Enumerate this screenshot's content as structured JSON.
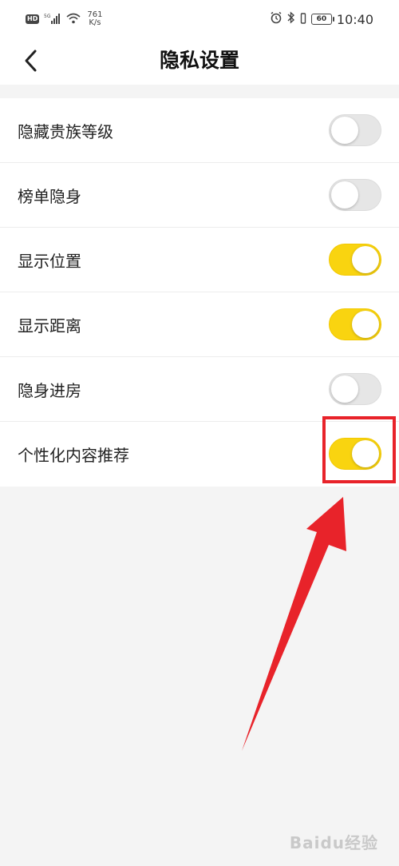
{
  "status_bar": {
    "hd_badge": "HD",
    "net_speed_value": "761",
    "net_speed_unit": "K/s",
    "battery": "60",
    "time": "10:40"
  },
  "nav": {
    "title": "隐私设置"
  },
  "settings": [
    {
      "label": "隐藏贵族等级",
      "enabled": false
    },
    {
      "label": "榜单隐身",
      "enabled": false
    },
    {
      "label": "显示位置",
      "enabled": true
    },
    {
      "label": "显示距离",
      "enabled": true
    },
    {
      "label": "隐身进房",
      "enabled": false
    },
    {
      "label": "个性化内容推荐",
      "enabled": true
    }
  ],
  "watermark": "Baidu经验",
  "colors": {
    "toggle_on": "#f9d410",
    "toggle_off": "#e6e6e6",
    "annotation_red": "#e8232a"
  }
}
